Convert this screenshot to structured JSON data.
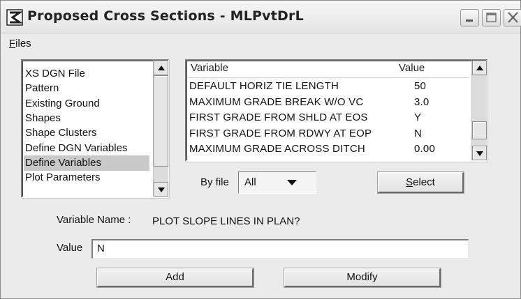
{
  "window": {
    "title": "Proposed Cross Sections - MLPvtDrL"
  },
  "menu": {
    "files_label": "Files"
  },
  "left_list": {
    "items": [
      {
        "label": "XS DGN File",
        "selected": false
      },
      {
        "label": "Pattern",
        "selected": false
      },
      {
        "label": "Existing Ground",
        "selected": false
      },
      {
        "label": "Shapes",
        "selected": false
      },
      {
        "label": "Shape Clusters",
        "selected": false
      },
      {
        "label": "Define DGN Variables",
        "selected": false
      },
      {
        "label": "Define Variables",
        "selected": true
      },
      {
        "label": "Plot Parameters",
        "selected": false
      }
    ]
  },
  "variables_table": {
    "headers": {
      "variable": "Variable",
      "value": "Value"
    },
    "rows": [
      {
        "variable": "DEFAULT HORIZ TIE LENGTH",
        "value": "50"
      },
      {
        "variable": "MAXIMUM GRADE BREAK W/O VC",
        "value": "3.0"
      },
      {
        "variable": "FIRST GRADE FROM SHLD AT EOS",
        "value": "Y"
      },
      {
        "variable": "FIRST GRADE FROM RDWY AT EOP",
        "value": "N"
      },
      {
        "variable": "MAXIMUM GRADE ACROSS DITCH",
        "value": "0.00"
      }
    ]
  },
  "filter": {
    "by_file_label": "By file",
    "by_file_value": "All",
    "select_label": "Select"
  },
  "details": {
    "variable_name_label": "Variable Name :",
    "variable_name_value": "PLOT SLOPE LINES IN PLAN?",
    "value_label": "Value",
    "value_value": "N"
  },
  "actions": {
    "add_label": "Add",
    "modify_label": "Modify"
  },
  "icons": {
    "app": "app-logo-icon",
    "minimize": "minimize-icon",
    "maximize": "maximize-icon",
    "close": "close-icon",
    "scroll_up": "chevron-up-icon",
    "scroll_down": "chevron-down-icon",
    "dropdown": "chevron-down-icon"
  }
}
